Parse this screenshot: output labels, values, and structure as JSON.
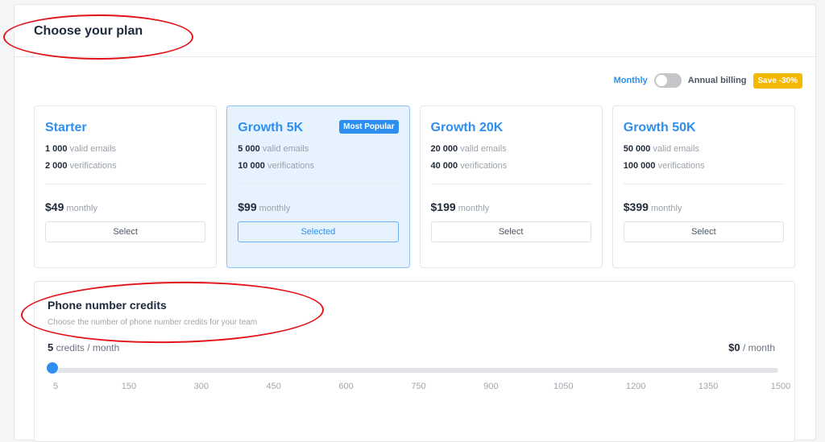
{
  "header": {
    "title": "Choose your plan"
  },
  "billing": {
    "monthly_label": "Monthly",
    "annual_label": "Annual billing",
    "annual_enabled": false,
    "save_badge": "Save -30%"
  },
  "plans": [
    {
      "name": "Starter",
      "emails": "1 000",
      "emails_label": "valid emails",
      "verifications": "2 000",
      "verifications_label": "verifications",
      "price": "$49",
      "period": "monthly",
      "button": "Select",
      "selected": false
    },
    {
      "name": "Growth 5K",
      "badge": "Most Popular",
      "emails": "5 000",
      "emails_label": "valid emails",
      "verifications": "10 000",
      "verifications_label": "verifications",
      "price": "$99",
      "period": "monthly",
      "button": "Selected",
      "selected": true
    },
    {
      "name": "Growth 20K",
      "emails": "20 000",
      "emails_label": "valid emails",
      "verifications": "40 000",
      "verifications_label": "verifications",
      "price": "$199",
      "period": "monthly",
      "button": "Select",
      "selected": false
    },
    {
      "name": "Growth 50K",
      "emails": "50 000",
      "emails_label": "valid emails",
      "verifications": "100 000",
      "verifications_label": "verifications",
      "price": "$399",
      "period": "monthly",
      "button": "Select",
      "selected": false
    }
  ],
  "credits": {
    "title": "Phone number credits",
    "subtitle": "Choose the number of phone number credits for your team",
    "value": "5",
    "value_label": "credits / month",
    "cost": "$0",
    "cost_label": "/ month",
    "slider": {
      "min": 5,
      "max": 1500,
      "current": 5
    },
    "ticks": [
      "5",
      "150",
      "300",
      "450",
      "600",
      "750",
      "900",
      "1050",
      "1200",
      "1350",
      "1500"
    ]
  },
  "colors": {
    "accent": "#2e8ff0",
    "badge": "#f5b800",
    "annotation": "#e2141a"
  }
}
